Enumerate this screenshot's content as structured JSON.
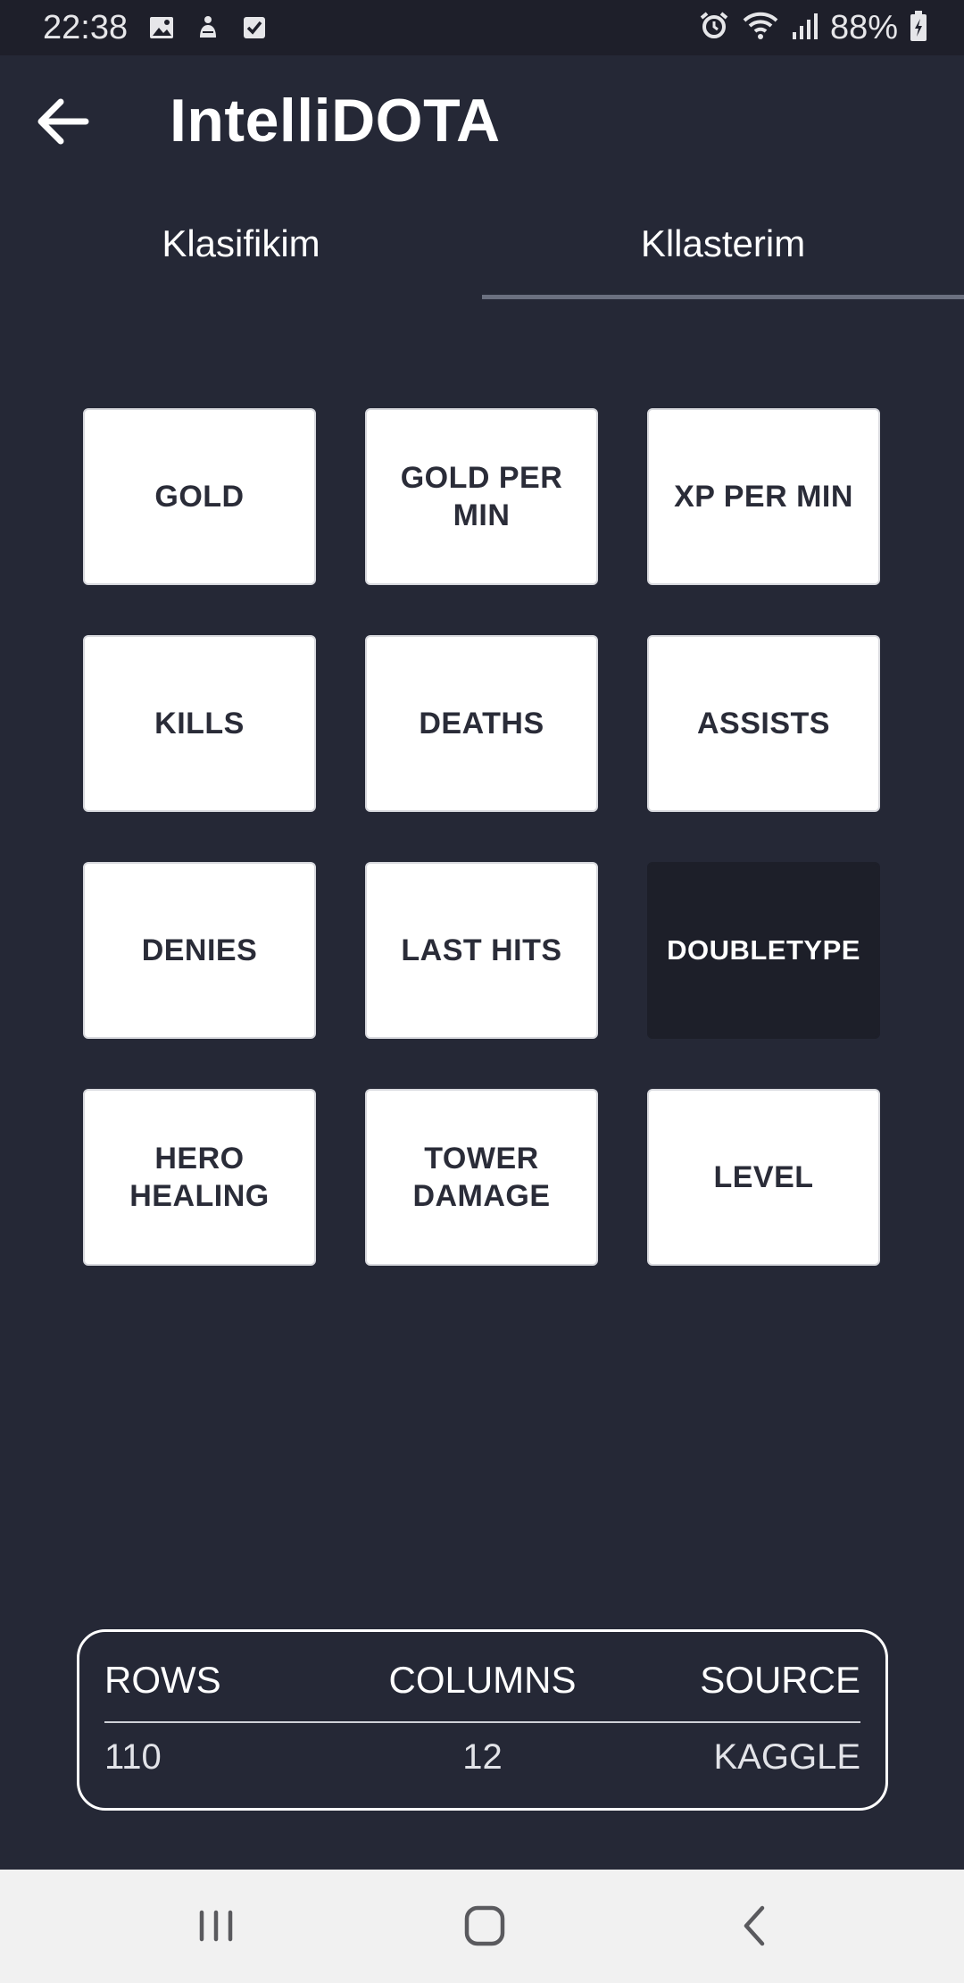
{
  "status_bar": {
    "time": "22:38",
    "battery": "88%",
    "left_icons": [
      "image-icon",
      "notification-icon",
      "checkbox-icon"
    ],
    "right_icons": [
      "alarm-icon",
      "wifi-icon",
      "signal-icon",
      "battery-icon"
    ]
  },
  "app_bar": {
    "title": "IntelliDOTA",
    "back_icon": "arrow-left-icon"
  },
  "tabs": [
    {
      "label": "Klasifikim",
      "active": false
    },
    {
      "label": "Kllasterim",
      "active": true
    }
  ],
  "features": [
    {
      "label": "GOLD",
      "selected": false
    },
    {
      "label": "GOLD PER MIN",
      "selected": false
    },
    {
      "label": "XP PER MIN",
      "selected": false
    },
    {
      "label": "KILLS",
      "selected": false
    },
    {
      "label": "DEATHS",
      "selected": false
    },
    {
      "label": "ASSISTS",
      "selected": false
    },
    {
      "label": "DENIES",
      "selected": false
    },
    {
      "label": "LAST HITS",
      "selected": false
    },
    {
      "label": "DOUBLETYPE",
      "selected": true
    },
    {
      "label": "HERO HEALING",
      "selected": false
    },
    {
      "label": "TOWER DAMAGE",
      "selected": false
    },
    {
      "label": "LEVEL",
      "selected": false
    }
  ],
  "dataset_info": {
    "headers": {
      "rows": "ROWS",
      "columns": "COLUMNS",
      "source": "SOURCE"
    },
    "values": {
      "rows": "110",
      "columns": "12",
      "source": "KAGGLE"
    }
  },
  "nav_bar": {
    "icons": [
      "recents-icon",
      "home-icon",
      "back-icon"
    ]
  },
  "colors": {
    "background": "#252836",
    "status_bar": "#1e1f2a",
    "tile": "#ffffff",
    "tile_selected": "#1d1f29",
    "tab_indicator": "#6b7080",
    "nav_bar": "#f1f1f1"
  }
}
